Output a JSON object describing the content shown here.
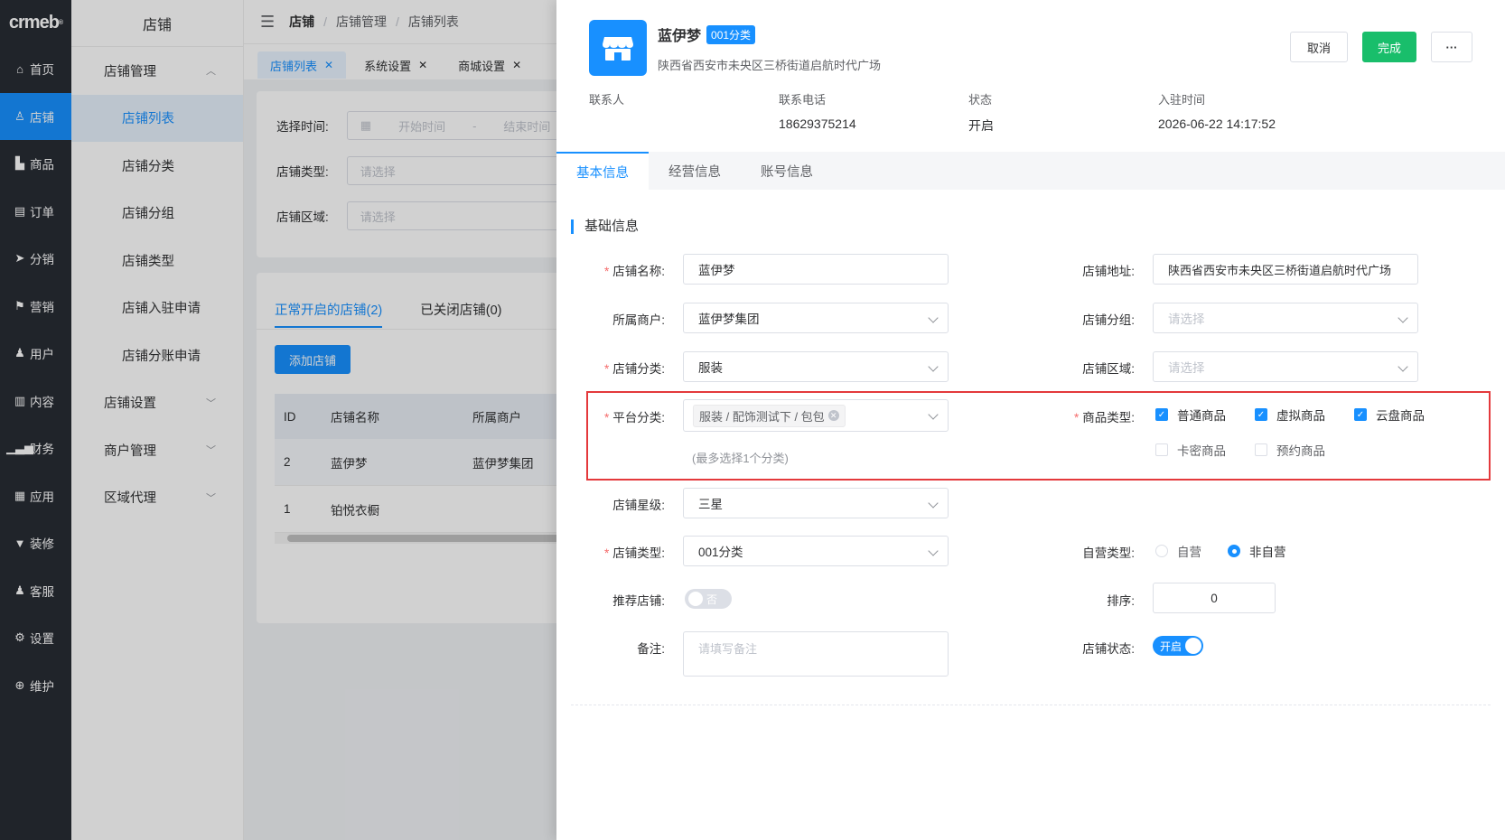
{
  "nav": {
    "logo": "crmeb",
    "items": [
      {
        "label": "首页",
        "icon": "home-icon"
      },
      {
        "label": "店铺",
        "icon": "store-icon"
      },
      {
        "label": "商品",
        "icon": "goods-icon"
      },
      {
        "label": "订单",
        "icon": "order-icon"
      },
      {
        "label": "分销",
        "icon": "distribution-icon"
      },
      {
        "label": "营销",
        "icon": "flag-icon"
      },
      {
        "label": "用户",
        "icon": "user-icon"
      },
      {
        "label": "内容",
        "icon": "content-icon"
      },
      {
        "label": "财务",
        "icon": "finance-icon"
      },
      {
        "label": "应用",
        "icon": "apps-icon"
      },
      {
        "label": "装修",
        "icon": "decorate-icon"
      },
      {
        "label": "客服",
        "icon": "service-icon"
      },
      {
        "label": "设置",
        "icon": "gear-icon"
      },
      {
        "label": "维护",
        "icon": "maintain-icon"
      }
    ]
  },
  "submenu": {
    "title": "店铺",
    "group1": "店铺管理",
    "items": [
      "店铺列表",
      "店铺分类",
      "店铺分组",
      "店铺类型",
      "店铺入驻申请",
      "店铺分账申请"
    ],
    "group2": "店铺设置",
    "group3": "商户管理",
    "group4": "区域代理"
  },
  "breadcrumb": {
    "first": "店铺",
    "second": "店铺管理",
    "third": "店铺列表"
  },
  "tabs": [
    "店铺列表",
    "系统设置",
    "商城设置"
  ],
  "filter": {
    "time_label": "选择时间:",
    "start_ph": "开始时间",
    "dash": "-",
    "end_ph": "结束时间",
    "type_label": "店铺类型:",
    "type_ph": "请选择",
    "area_label": "店铺区域:",
    "area_ph": "请选择"
  },
  "list": {
    "tab_open": "正常开启的店铺(2)",
    "tab_closed": "已关闭店铺(0)",
    "add_button": "添加店铺",
    "columns": [
      "ID",
      "店铺名称",
      "所属商户"
    ],
    "rows": [
      [
        "2",
        "蓝伊梦",
        "蓝伊梦集团"
      ],
      [
        "1",
        "铂悦衣橱",
        ""
      ]
    ]
  },
  "drawer": {
    "store_name": "蓝伊梦",
    "badge": "001分类",
    "address": "陕西省西安市未央区三桥街道启航时代广场",
    "cancel": "取消",
    "done": "完成",
    "more": "···",
    "meta": [
      {
        "label": "联系人",
        "value": ""
      },
      {
        "label": "联系电话",
        "value": "18629375214"
      },
      {
        "label": "状态",
        "value": "开启"
      },
      {
        "label": "入驻时间",
        "value": "2026-06-22 14:17:52"
      }
    ],
    "tabs": [
      "基本信息",
      "经营信息",
      "账号信息"
    ],
    "section_title": "基础信息"
  },
  "form": {
    "name_label": "店铺名称:",
    "name_value": "蓝伊梦",
    "addr_label": "店铺地址:",
    "addr_value": "陕西省西安市未央区三桥街道启航时代广场",
    "merchant_label": "所属商户:",
    "merchant_value": "蓝伊梦集团",
    "group_label": "店铺分组:",
    "group_ph": "请选择",
    "category_label": "店铺分类:",
    "category_value": "服装",
    "area_label": "店铺区域:",
    "area_ph": "请选择",
    "platform_label": "平台分类:",
    "platform_tag": "服装 / 配饰测试下 / 包包",
    "platform_hint": "(最多选择1个分类)",
    "goods_type_label": "商品类型:",
    "goods_types": [
      {
        "label": "普通商品",
        "checked": true
      },
      {
        "label": "虚拟商品",
        "checked": true
      },
      {
        "label": "云盘商品",
        "checked": true
      },
      {
        "label": "卡密商品",
        "checked": false
      },
      {
        "label": "预约商品",
        "checked": false
      }
    ],
    "star_label": "店铺星级:",
    "star_value": "三星",
    "type_label": "店铺类型:",
    "type_value": "001分类",
    "self_label": "自营类型:",
    "self_opt1": "自营",
    "self_opt2": "非自营",
    "recommend_label": "推荐店铺:",
    "recommend_value": "否",
    "sort_label": "排序:",
    "sort_value": "0",
    "remark_label": "备注:",
    "remark_ph": "请填写备注",
    "status_label": "店铺状态:",
    "status_value": "开启"
  },
  "colors": {
    "primary": "#1890ff",
    "success": "#19be6b",
    "highlight": "#e4393c",
    "nav_bg": "#282c34"
  }
}
